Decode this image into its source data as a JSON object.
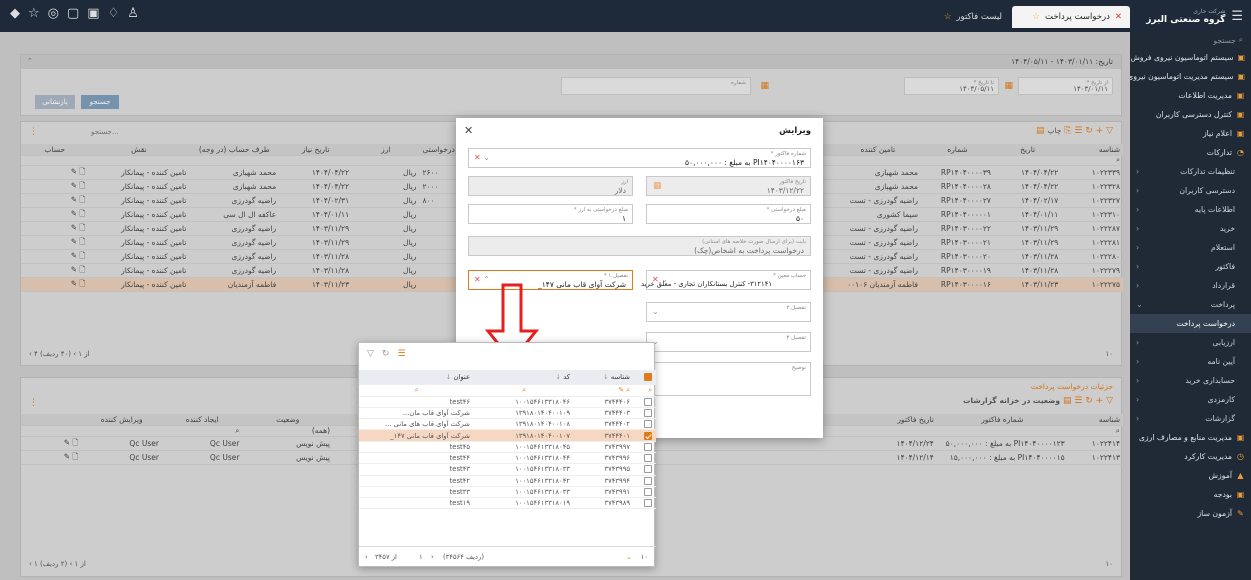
{
  "topbar": {
    "brand_sub": "شرکت جاری",
    "brand_name": "گروه صنعتی البرز",
    "tabs": [
      {
        "label": "درخواست پرداخت"
      },
      {
        "label": "لیست فاکتور"
      }
    ]
  },
  "sidebar": {
    "search": "جستجو",
    "items": [
      {
        "label": "سیستم اتوماسیون نیروی فروش"
      },
      {
        "label": "سیستم مدیریت اتوماسیون نیروی فروش"
      },
      {
        "label": "مدیریت اطلاعات"
      },
      {
        "label": "کنترل دسترسی کاربران"
      },
      {
        "label": "اعلام نیاز"
      },
      {
        "label": "تدارکات"
      },
      {
        "label": "تنظیمات تدارکات"
      },
      {
        "label": "دسترسی کاربران"
      },
      {
        "label": "اطلاعات پایه"
      },
      {
        "label": "خرید"
      },
      {
        "label": "استعلام"
      },
      {
        "label": "فاکتور"
      },
      {
        "label": "قرارداد"
      },
      {
        "label": "پرداخت"
      },
      {
        "label": "درخواست پرداخت"
      },
      {
        "label": "ارزیابی"
      },
      {
        "label": "آیین نامه"
      },
      {
        "label": "حسابداری خرید"
      },
      {
        "label": "کارمزدی"
      },
      {
        "label": "گزارشات"
      },
      {
        "label": "مدیریت منابع و مصارف ارزی"
      },
      {
        "label": "مدیریت کارکرد"
      },
      {
        "label": "آموزش"
      },
      {
        "label": "بودجه"
      },
      {
        "label": "آزمون ساز"
      }
    ]
  },
  "filter": {
    "date_label": "تاریخ: ۱۴۰۳/۰۱/۱۱ - ۱۴۰۴/۰۵/۱۱",
    "from_label": "از تاریخ *",
    "from_value": "۱۴۰۳/۰۱/۱۱",
    "to_label": "تا تاریخ *",
    "to_value": "۱۴۰۴/۰۵/۱۱",
    "number_label": "شماره",
    "search_btn": "جستجو",
    "reset_btn": "بازنشانی"
  },
  "upper_grid": {
    "print_label": "چاپ",
    "search_placeholder": "جستجو...",
    "columns": [
      "شناسه",
      "تاریخ",
      "شماره",
      "تامین کننده",
      "درخواستی",
      "ارز",
      "تاریخ نیاز",
      "طرف حساب (در وجه)",
      "نقش",
      "حساب"
    ],
    "rows": [
      {
        "id": "۱۰۲۲۳۳۹",
        "date": "۱۴۰۴/۰۴/۲۲",
        "no": "RP۱۴۰۴۰۰۰۰۳۹",
        "supplier": "محمد شهبازی",
        "amount": "۲۶۰۰",
        "cur": "ریال",
        "need": "۱۴۰۴/۰۴/۲۲",
        "party": "محمد شهبازی",
        "role": "تامین کننده - پیمانکار"
      },
      {
        "id": "۱۰۲۲۳۲۸",
        "date": "۱۴۰۴/۰۴/۲۲",
        "no": "RP۱۴۰۴۰۰۰۰۲۸",
        "supplier": "محمد شهبازی",
        "amount": "۲۰۰۰",
        "cur": "ریال",
        "need": "۱۴۰۴/۰۴/۲۲",
        "party": "محمد شهبازی",
        "role": "تامین کننده - پیمانکار"
      },
      {
        "id": "۱۰۲۲۳۲۷",
        "date": "۱۴۰۴/۰۲/۱۷",
        "no": "RP۱۴۰۴۰۰۰۰۲۷",
        "supplier": "راضیه گودرزی - تست",
        "amount": "۸۰۰",
        "cur": "ریال",
        "need": "۱۴۰۴/۰۲/۳۱",
        "party": "راضیه گودرزی",
        "role": "تامین کننده - پیمانکار"
      },
      {
        "id": "۱۰۲۲۳۱۰",
        "date": "۱۴۰۴/۰۱/۱۱",
        "no": "RP۱۴۰۴۰۰۰۰۰۱",
        "supplier": "سیما کشوری",
        "amount": "",
        "cur": "ریال",
        "need": "۱۴۰۴/۰۱/۱۱",
        "party": "عاکفه ال ال سی",
        "role": "تامین کننده - پیمانکار"
      },
      {
        "id": "۱۰۲۲۲۸۷",
        "date": "۱۴۰۳/۱۱/۲۹",
        "no": "RP۱۴۰۳۰۰۰۰۲۲",
        "supplier": "راضیه گودرزی - تست",
        "amount": "",
        "cur": "ریال",
        "need": "۱۴۰۳/۱۱/۲۹",
        "party": "راضیه گودرزی",
        "role": "تامین کننده - پیمانکار"
      },
      {
        "id": "۱۰۲۲۲۸۱",
        "date": "۱۴۰۳/۱۱/۲۹",
        "no": "RP۱۴۰۳۰۰۰۰۲۱",
        "supplier": "راضیه گودرزی - تست",
        "amount": "",
        "cur": "ریال",
        "need": "۱۴۰۳/۱۱/۲۹",
        "party": "راضیه گودرزی",
        "role": "تامین کننده - پیمانکار"
      },
      {
        "id": "۱۰۲۲۲۸۰",
        "date": "۱۴۰۳/۱۱/۲۸",
        "no": "RP۱۴۰۳۰۰۰۰۲۰",
        "supplier": "راضیه گودرزی - تست",
        "amount": "",
        "cur": "ریال",
        "need": "۱۴۰۳/۱۱/۲۸",
        "party": "راضیه گودرزی",
        "role": "تامین کننده - پیمانکار"
      },
      {
        "id": "۱۰۲۲۲۷۹",
        "date": "۱۴۰۳/۱۱/۲۸",
        "no": "RP۱۴۰۳۰۰۰۰۱۹",
        "supplier": "راضیه گودرزی - تست",
        "amount": "",
        "cur": "ریال",
        "need": "۱۴۰۳/۱۱/۲۸",
        "party": "راضیه گودرزی",
        "role": "تامین کننده - پیمانکار"
      },
      {
        "id": "۱۰۲۲۲۷۵",
        "date": "۱۴۰۳/۱۱/۲۳",
        "no": "RP۱۴۰۳۰۰۰۰۱۶",
        "supplier": "فاطمه آزمندیان ۰۰۱۰۶",
        "amount": "",
        "cur": "ریال",
        "need": "۱۴۰۳/۱۱/۲۳",
        "party": "فاطمه آزمندیان",
        "role": "تامین کننده - پیمانکار"
      }
    ],
    "pager": "(۴۰ ردیف)",
    "pager_page": "۱",
    "pager_of": "۴ از",
    "page_size": "۱۰"
  },
  "lower_grid": {
    "title": "جزئیات درخواست پرداخت",
    "reports_label": "گزارشات",
    "status_label": "وضعیت در خزانه",
    "columns": [
      "شناسه",
      "شماره فاکتور",
      "تاریخ فاکتور",
      "وضعیت",
      "ایجاد کننده",
      "ویرایش کننده"
    ],
    "status_filter": "(همه)",
    "rows": [
      {
        "id": "۱۰۲۲۴۱۴",
        "invoice": "PI۱۴۰۴۰۰۰۰۱۲۳ به مبلغ : ۵۰,۰۰۰,۰۰۰",
        "date": "۱۴۰۴/۱۲/۲۴",
        "status": "پیش نویس",
        "creator": "Qc User",
        "editor": "Qc User"
      },
      {
        "id": "۱۰۲۲۴۱۳",
        "invoice": "PI۱۴۰۴۰۰۰۰۱۵ به مبلغ : ۱۵,۰۰۰,۰۰۰",
        "date": "۱۴۰۴/۱۲/۱۴",
        "status": "پیش نویس",
        "creator": "Qc User",
        "editor": "Qc User"
      }
    ],
    "pager": "(۲ ردیف)",
    "pager_page": "۱",
    "pager_of": "۱ از",
    "page_size": "۱۰"
  },
  "dialog": {
    "title": "ویرایش",
    "invoice_label": "شماره فاکتور *",
    "invoice_value": "PI۱۴۰۴۰۰۰۰۱۶۳ به مبلغ : ۵۰,۰۰۰,۰۰۰",
    "date_label": "تاریخ فاکتور",
    "date_value": "۱۴۰۳/۱۲/۲۲",
    "currency_label": "ارز",
    "currency_value": "دلار",
    "req_amount_label": "مبلغ درخواستی *",
    "req_amount_value": "۵۰",
    "req_amount_cur_label": "مبلغ درخواستی به ارز *",
    "req_amount_cur_value": "۱",
    "desc_label": "بابت (برای ارسال صورت خلاصه های استانی)",
    "desc_value": "درخواست پرداخت به اشخاص(چک)",
    "account_label": "حساب معین *",
    "account_value": "۳۱۲۱۴۱- کنترل بستانکاران تجاری - معلق خرید",
    "detail1_label": "تفصیل ۱ *",
    "detail1_value": "شرکت آوای قاب مانی ۱۴۷_",
    "detail2_label": "تفصیل ۲",
    "detail3_label": "تفصیل ۳",
    "notes_label": "توضیح"
  },
  "popup": {
    "columns": [
      "شناسه",
      "کد",
      "عنوان"
    ],
    "rows": [
      {
        "checked": false,
        "id": "۳۷۴۴۴۰۶",
        "code": "۱۰۰۱۵۴۶۱۳۳۱۸۰۴۶",
        "title": "test۴۶"
      },
      {
        "checked": false,
        "id": "۳۷۴۴۴۰۳",
        "code": "۱۳۹۱۸۰۱۴۰۴۰۰۱۰۹",
        "title": "شرکت آوای قاب مان..."
      },
      {
        "checked": false,
        "id": "۳۷۴۴۴۰۲",
        "code": "۱۳۹۱۸۰۱۴۰۴۰۰۱۰۸",
        "title": "شرکت آوای قاب های مانی ..."
      },
      {
        "checked": true,
        "id": "۳۷۴۴۴۰۱",
        "code": "۱۳۹۱۸۰۱۴۰۴۰۰۱۰۷",
        "title": "شرکت آوای قاب مانی ۱۴۷_"
      },
      {
        "checked": false,
        "id": "۳۷۴۳۹۹۷",
        "code": "۱۰۰۱۵۴۶۱۳۳۱۸۰۴۵",
        "title": "test۴۵"
      },
      {
        "checked": false,
        "id": "۳۷۴۳۹۹۶",
        "code": "۱۰۰۱۵۴۶۱۳۳۱۸۰۴۴",
        "title": "test۴۴"
      },
      {
        "checked": false,
        "id": "۳۷۴۳۹۹۵",
        "code": "۱۰۰۱۵۴۶۱۳۳۱۸۰۳۳",
        "title": "test۴۳"
      },
      {
        "checked": false,
        "id": "۳۷۴۳۹۹۴",
        "code": "۱۰۰۱۵۴۶۱۳۳۱۸۰۴۲",
        "title": "test۴۲"
      },
      {
        "checked": false,
        "id": "۳۷۴۳۹۹۱",
        "code": "۱۰۰۱۵۴۶۱۳۳۱۸۰۳۳",
        "title": "test۳۳"
      },
      {
        "checked": false,
        "id": "۳۷۴۳۹۸۹",
        "code": "۱۰۰۱۵۴۶۱۳۳۱۸۰۱۹",
        "title": "test۱۹"
      }
    ],
    "pager": "(۳۴۵۶۴ ردیف)",
    "pager_page": "۱",
    "pager_of": "۳۴۵۷ از",
    "page_size": "۱۰"
  }
}
